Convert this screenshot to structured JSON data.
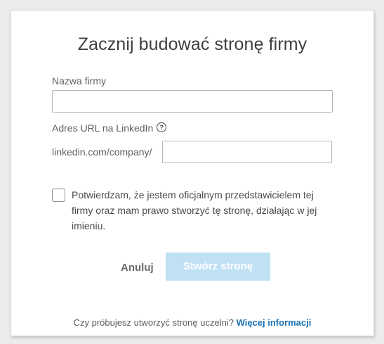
{
  "dialog": {
    "title": "Zacznij budować stronę firmy",
    "company_name_label": "Nazwa firmy",
    "company_name_value": "",
    "url_label": "Adres URL na LinkedIn",
    "url_prefix": "linkedin.com/company/",
    "url_value": "",
    "confirm_text": "Potwierdzam, że jestem oficjalnym przedstawicielem tej\nfirmy oraz mam prawo stworzyć tę stronę, działając w jej\nimieniu.",
    "confirm_checked": false,
    "cancel_label": "Anuluj",
    "create_label": "Stwórz stronę",
    "footer_question": "Czy próbujesz utworzyć stronę uczelni?",
    "footer_link": "Więcej informacji"
  },
  "colors": {
    "primary_disabled": "#c0e1f4",
    "link": "#1a73b5"
  },
  "icons": {
    "help": "help-icon"
  }
}
